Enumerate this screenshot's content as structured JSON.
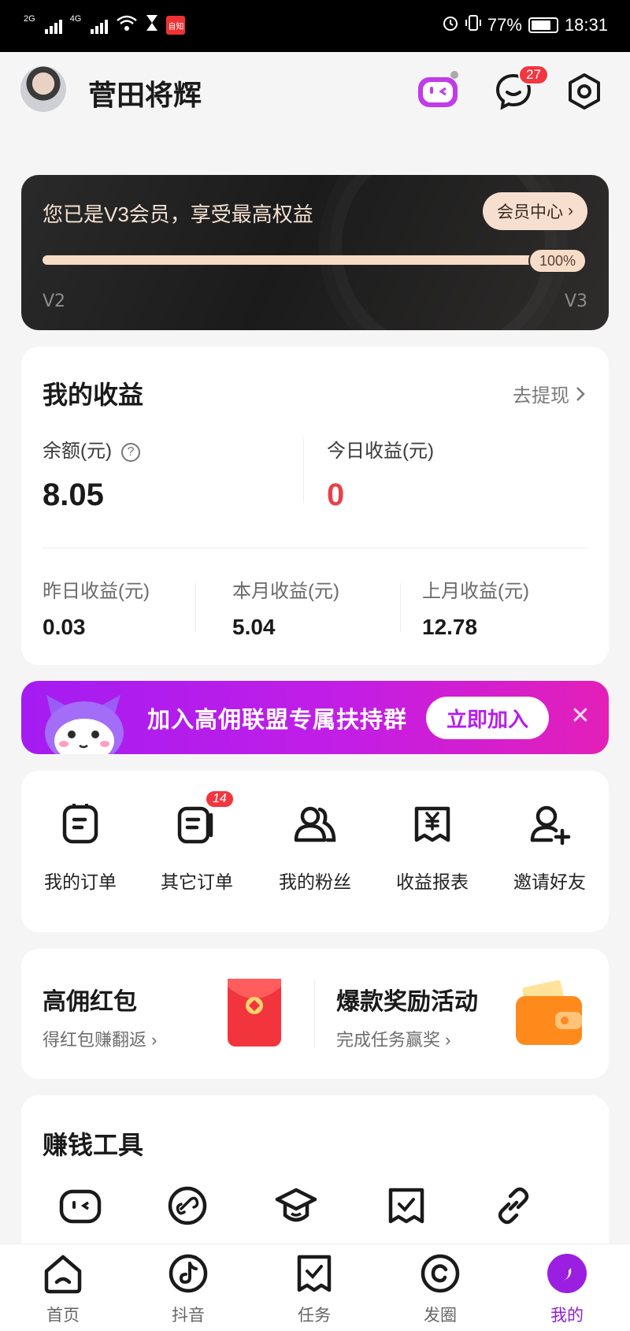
{
  "status_bar": {
    "time": "18:31",
    "battery": "77%",
    "net1": "2G",
    "net2": "4G",
    "news_badge": "自知"
  },
  "profile": {
    "name": "菅田将辉",
    "message_count": "27"
  },
  "vip": {
    "title": "您已是V3会员，享受最高权益",
    "center_button": "会员中心",
    "progress_label": "100%",
    "progress_fraction": 1.0,
    "level_from": "V2",
    "level_to": "V3"
  },
  "earnings": {
    "title": "我的收益",
    "withdraw": "去提现",
    "balance_label": "余额(元)",
    "balance_value": "8.05",
    "today_label": "今日收益(元)",
    "today_value": "0",
    "today_color": "#e8414a",
    "yesterday_label": "昨日收益(元)",
    "yesterday_value": "0.03",
    "month_label": "本月收益(元)",
    "month_value": "5.04",
    "last_month_label": "上月收益(元)",
    "last_month_value": "12.78"
  },
  "banner": {
    "text": "加入高佣联盟专属扶持群",
    "button": "立即加入"
  },
  "shortcuts": [
    {
      "label": "我的订单",
      "icon": "order-icon"
    },
    {
      "label": "其它订单",
      "icon": "other-orders-icon",
      "badge": "14"
    },
    {
      "label": "我的粉丝",
      "icon": "fans-icon"
    },
    {
      "label": "收益报表",
      "icon": "report-icon"
    },
    {
      "label": "邀请好友",
      "icon": "invite-icon"
    }
  ],
  "promos": [
    {
      "title": "高佣红包",
      "subtitle": "得红包赚翻返",
      "icon": "red-envelope-icon"
    },
    {
      "title": "爆款奖励活动",
      "subtitle": "完成任务赢奖",
      "icon": "wallet-icon"
    }
  ],
  "tools": {
    "title": "赚钱工具"
  },
  "tabs": [
    {
      "label": "首页",
      "icon": "home-icon"
    },
    {
      "label": "抖音",
      "icon": "douyin-icon"
    },
    {
      "label": "任务",
      "icon": "task-icon"
    },
    {
      "label": "发圈",
      "icon": "moments-icon"
    },
    {
      "label": "我的",
      "icon": "profile-icon",
      "active": true
    }
  ],
  "colors": {
    "accent": "#8f1fd9",
    "badge": "#f2363f",
    "vip_gold": "#f7dcc8"
  }
}
